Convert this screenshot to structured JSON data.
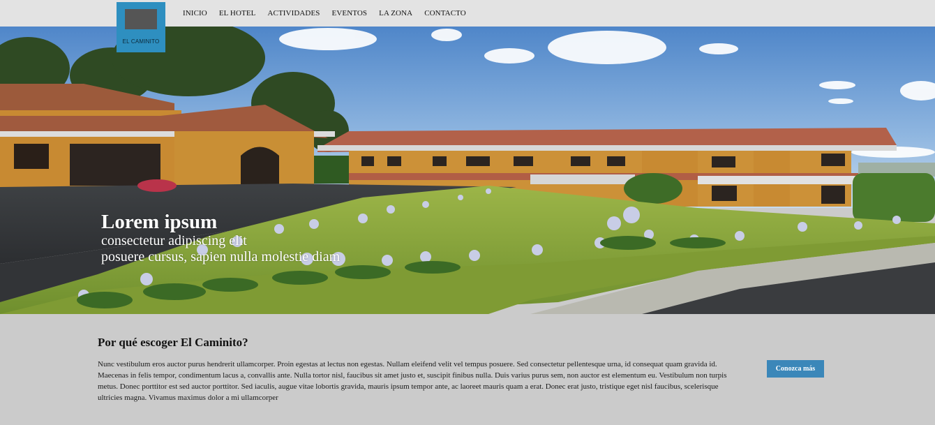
{
  "brand": {
    "logo_text": "EL CAMINITO"
  },
  "nav": {
    "items": [
      {
        "label": "INICIO"
      },
      {
        "label": "EL HOTEL"
      },
      {
        "label": "ACTIVIDADES"
      },
      {
        "label": "EVENTOS"
      },
      {
        "label": "LA ZONA"
      },
      {
        "label": "CONTACTO"
      }
    ]
  },
  "hero": {
    "title": "Lorem ipsum",
    "line1": "consectetur adipiscing elit",
    "line2": "posuere cursus, sapien nulla molestie diam"
  },
  "section": {
    "heading": "Por qué escoger El Caminito?",
    "body": "Nunc vestibulum eros auctor purus hendrerit ullamcorper. Proin egestas at lectus non egestas. Nullam eleifend velit vel tempus posuere. Sed consectetur pellentesque urna, id consequat quam gravida id. Maecenas in felis tempor, condimentum lacus a, convallis ante. Nulla tortor nisl, faucibus sit amet justo et, suscipit finibus nulla. Duis varius purus sem, non auctor est elementum eu. Vestibulum non turpis metus. Donec porttitor est sed auctor porttitor. Sed iaculis, augue vitae lobortis gravida, mauris ipsum tempor ante, ac laoreet mauris quam a erat. Donec erat justo, tristique eget nisl faucibus, scelerisque ultricies magna. Vivamus maximus dolor a mi ullamcorper",
    "button_label": "Conozca más"
  },
  "colors": {
    "topbar": "#e3e3e3",
    "logo": "#2e8fc0",
    "button": "#3b87b9",
    "content_bg": "#cbcbcb"
  }
}
